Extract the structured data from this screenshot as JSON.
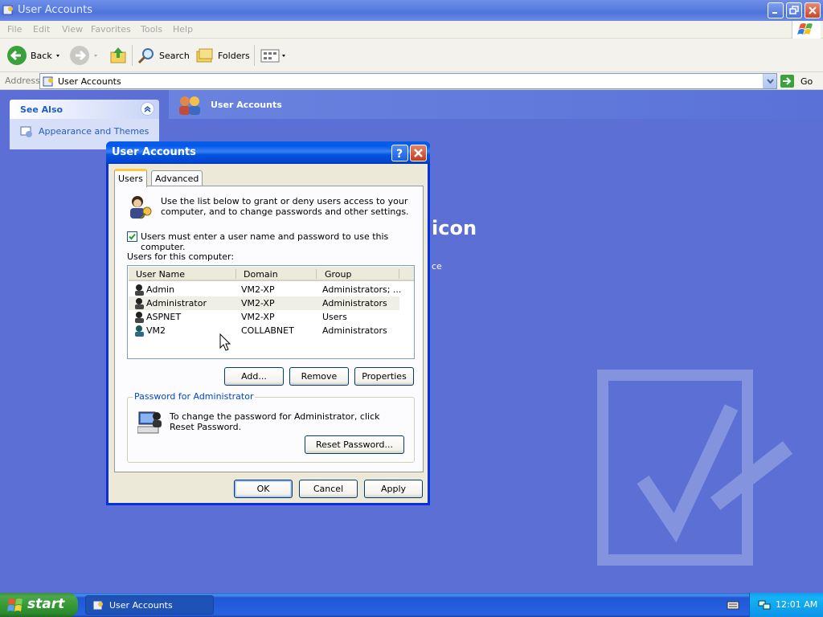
{
  "window": {
    "title": "User Accounts",
    "menu": [
      "File",
      "Edit",
      "View",
      "Favorites",
      "Tools",
      "Help"
    ],
    "toolbar": {
      "back": "Back",
      "search": "Search",
      "folders": "Folders"
    },
    "address": {
      "label": "Address",
      "value": "User Accounts",
      "go": "Go"
    }
  },
  "sidebar": {
    "see_also_title": "See Also",
    "link": "Appearance and Themes"
  },
  "content": {
    "header": "User Accounts",
    "bg_heading": "icon",
    "bg_sub": "ce"
  },
  "dialog": {
    "title": "User Accounts",
    "tabs": [
      "Users",
      "Advanced"
    ],
    "intro": "Use the list below to grant or deny users access to your computer, and to change passwords and other settings.",
    "checkbox_label": "Users must enter a user name and password to use this computer.",
    "checkbox_checked": true,
    "users_label": "Users for this computer:",
    "columns": [
      "User Name",
      "Domain",
      "Group"
    ],
    "users": [
      {
        "name": "Admin",
        "domain": "VM2-XP",
        "group": "Administrators; ..."
      },
      {
        "name": "Administrator",
        "domain": "VM2-XP",
        "group": "Administrators"
      },
      {
        "name": "ASPNET",
        "domain": "VM2-XP",
        "group": "Users"
      },
      {
        "name": "VM2",
        "domain": "COLLABNET",
        "group": "Administrators"
      }
    ],
    "buttons": {
      "add": "Add...",
      "remove": "Remove",
      "properties": "Properties"
    },
    "password_group": {
      "legend": "Password for Administrator",
      "text": "To change the password for Administrator, click Reset Password.",
      "reset": "Reset Password..."
    },
    "footer": {
      "ok": "OK",
      "cancel": "Cancel",
      "apply": "Apply"
    }
  },
  "taskbar": {
    "start": "start",
    "task": "User Accounts",
    "clock": "12:01 AM"
  }
}
